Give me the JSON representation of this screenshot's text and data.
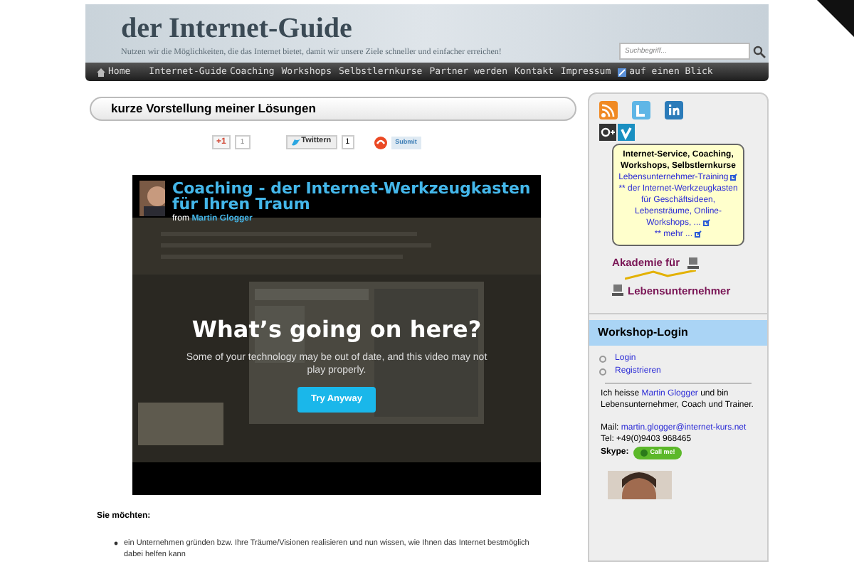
{
  "header": {
    "title": "der Internet-Guide",
    "tagline": "Nutzen wir die Möglichkeiten, die das Internet bietet, damit wir unsere Ziele schneller und einfacher erreichen!",
    "search_placeholder": "Suchbegriff..."
  },
  "nav": [
    {
      "label": "Home",
      "kind": "home"
    },
    {
      "label": "Internet-Guide",
      "kind": "plain"
    },
    {
      "label": "Coaching",
      "kind": "plain"
    },
    {
      "label": "Workshops",
      "kind": "plain"
    },
    {
      "label": "Selbstlernkurse",
      "kind": "plain"
    },
    {
      "label": "Partner werden",
      "kind": "plain"
    },
    {
      "label": "Kontakt",
      "kind": "plain"
    },
    {
      "label": "Impressum",
      "kind": "plain"
    },
    {
      "label": "auf einen Blick",
      "kind": "icon"
    }
  ],
  "section_title": "kurze Vorstellung meiner Lösungen",
  "share": {
    "gplus_label": "+1",
    "gplus_count": "1",
    "twitter_label": "Twittern",
    "twitter_count": "1",
    "submit_label": "Submit"
  },
  "video": {
    "title": "Coaching - der Internet-Werkzeugkasten für Ihren Traum",
    "from": "from",
    "author": "Martin Glogger",
    "heading": "What’s going on here?",
    "message": "Some of your technology may be out of date, and this video may not play properly.",
    "button": "Try Anyway"
  },
  "content": {
    "heading": "Sie möchten:",
    "bullets": [
      "ein Unternehmen gründen bzw. Ihre Träume/Visionen realisieren und nun wissen, wie Ihnen das Internet bestmöglich dabei helfen kann"
    ]
  },
  "sidebar": {
    "info_title": "Internet-Service, Coaching, Workshops, Selbstlernkurse",
    "info_links": [
      "Lebensunternehmer-Training",
      "** der Internet-Werkzeugkasten für Geschäftsideen, Lebensträume, Online-Workshops, ...",
      "** mehr ..."
    ],
    "logo_top": "Akademie für",
    "logo_bottom": "Lebensunternehmer",
    "login_title": "Workshop-Login",
    "login_links": [
      "Login",
      "Registrieren"
    ],
    "bio_start": "Ich heisse",
    "bio_link": "Martin Glogger",
    "bio_end": "und bin Lebensunternehmer, Coach und Trainer.",
    "mail_label": "Mail:",
    "mail": "martin.glogger@internet-kurs.net",
    "tel": "Tel: +49(0)9403 968465",
    "skype_label": "Skype:",
    "skype_button": "Call me!"
  }
}
